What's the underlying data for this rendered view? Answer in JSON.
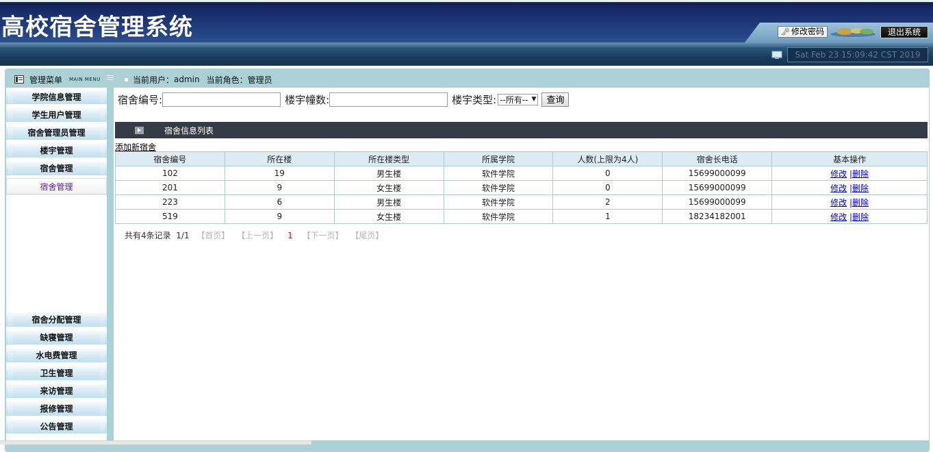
{
  "header": {
    "title": "高校宿舍管理系统",
    "change_password": "修改密码",
    "logout": "退出系统",
    "datetime": "Sat Feb 23 15:09:42 CST 2019"
  },
  "menu": {
    "title": "管理菜单",
    "subtitle": "MAIN MENU"
  },
  "user_info": {
    "current_user_label": "当前用户：",
    "current_user": "admin",
    "current_role_label": "当前角色：",
    "current_role": "管理员"
  },
  "sidebar": {
    "items": [
      {
        "label": "学院信息管理"
      },
      {
        "label": "学生用户管理"
      },
      {
        "label": "宿舍管理员管理"
      },
      {
        "label": "楼宇管理"
      },
      {
        "label": "宿舍管理"
      },
      {
        "label": "宿舍管理"
      },
      {
        "label": "宿舍分配管理"
      },
      {
        "label": "缺寝管理"
      },
      {
        "label": "水电费管理"
      },
      {
        "label": "卫生管理"
      },
      {
        "label": "来访管理"
      },
      {
        "label": "报修管理"
      },
      {
        "label": "公告管理"
      }
    ],
    "active_index": 5
  },
  "search": {
    "dorm_no_label": "宿舍编号:",
    "dorm_no_value": "",
    "building_count_label": "楼宇幢数:",
    "building_count_value": "",
    "building_type_label": "楼宇类型:",
    "building_type_selected": "--所有--",
    "query_button": "查询"
  },
  "list": {
    "title": "宿舍信息列表",
    "add_link": "添加新宿舍",
    "columns": [
      "宿舍编号",
      "所在楼",
      "所在楼类型",
      "所属学院",
      "人数(上限为4人)",
      "宿舍长电话",
      "基本操作"
    ],
    "rows": [
      {
        "dorm_no": "102",
        "building": "19",
        "type": "男生楼",
        "college": "软件学院",
        "count": "0",
        "phone": "15699000099"
      },
      {
        "dorm_no": "201",
        "building": "9",
        "type": "女生楼",
        "college": "软件学院",
        "count": "0",
        "phone": "15699000099"
      },
      {
        "dorm_no": "223",
        "building": "6",
        "type": "男生楼",
        "college": "软件学院",
        "count": "2",
        "phone": "15699000099"
      },
      {
        "dorm_no": "519",
        "building": "9",
        "type": "女生楼",
        "college": "软件学院",
        "count": "1",
        "phone": "18234182001"
      }
    ],
    "edit_label": "修改",
    "delete_label": "删除",
    "separator": "|"
  },
  "pagination": {
    "total_text": "共有4条记录",
    "page_text": "1/1",
    "first": "【首页】",
    "prev": "【上一页】",
    "current": "1",
    "next": "【下一页】",
    "last": "【尾页】"
  }
}
